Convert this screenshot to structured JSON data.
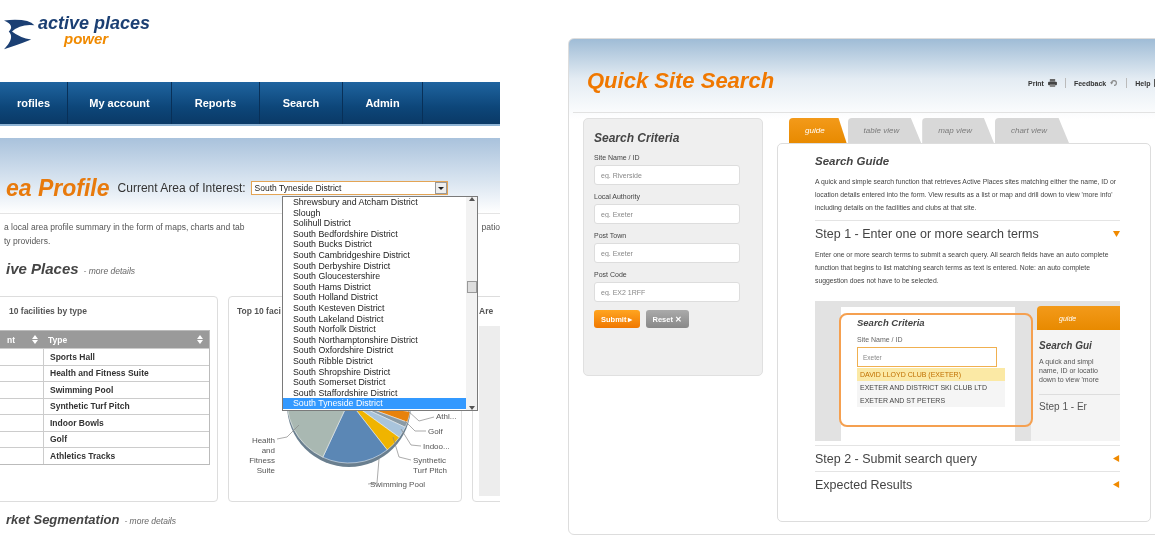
{
  "area_profile": {
    "logo": {
      "title": "active places",
      "subtitle": "power"
    },
    "nav": [
      {
        "label": "rofiles"
      },
      {
        "label": "My account"
      },
      {
        "label": "Reports"
      },
      {
        "label": "Search"
      },
      {
        "label": "Admin"
      }
    ],
    "page_title": "ea Profile",
    "area_label": "Current Area of Interest:",
    "area_select": {
      "value": "South Tyneside District",
      "expanded": true,
      "options": [
        {
          "label": "Shrewsbury and Atcham District",
          "selected": false
        },
        {
          "label": "Slough",
          "selected": false
        },
        {
          "label": "Solihull District",
          "selected": false
        },
        {
          "label": "South Bedfordshire District",
          "selected": false
        },
        {
          "label": "South Bucks District",
          "selected": false
        },
        {
          "label": "South Cambridgeshire District",
          "selected": false
        },
        {
          "label": "South Derbyshire District",
          "selected": false
        },
        {
          "label": "South Gloucestershire",
          "selected": false
        },
        {
          "label": "South Hams District",
          "selected": false
        },
        {
          "label": "South Holland District",
          "selected": false
        },
        {
          "label": "South Kesteven District",
          "selected": false
        },
        {
          "label": "South Lakeland District",
          "selected": false
        },
        {
          "label": "South Norfolk District",
          "selected": false
        },
        {
          "label": "South Northamptonshire District",
          "selected": false
        },
        {
          "label": "South Oxfordshire District",
          "selected": false
        },
        {
          "label": "South Ribble District",
          "selected": false
        },
        {
          "label": "South Shropshire District",
          "selected": false
        },
        {
          "label": "South Somerset District",
          "selected": false
        },
        {
          "label": "South Staffordshire District",
          "selected": false
        },
        {
          "label": "South Tyneside District",
          "selected": true
        }
      ]
    },
    "intro": {
      "line1": "a local area profile summary in the form of maps, charts and tab",
      "line1_right": "patio",
      "line2": "ty providers."
    },
    "section": {
      "heading": "ive Places",
      "more": "- more details"
    },
    "table_card": {
      "title": "10 facilities by type",
      "columns": [
        "nt",
        "Type"
      ],
      "rows": [
        "Sports Hall",
        "Health and Fitness Suite",
        "Swimming Pool",
        "Synthetic Turf Pitch",
        "Indoor Bowls",
        "Golf",
        "Athletics Tracks"
      ]
    },
    "chart_card": {
      "title": "Top 10 faci",
      "pie_labels": [
        {
          "lines": [
            "Athl..."
          ]
        },
        {
          "lines": [
            "Golf"
          ]
        },
        {
          "lines": [
            "Indoo..."
          ]
        },
        {
          "lines": [
            "Synthetic",
            "Turf Pitch"
          ]
        },
        {
          "lines": [
            "Swimming Pool"
          ]
        },
        {
          "lines": [
            "Health",
            "and",
            "Fitness",
            "Suite"
          ]
        }
      ]
    },
    "map_card": {
      "title": "Are"
    },
    "footer_section": {
      "heading": "rket Segmentation",
      "more": "- more details"
    }
  },
  "quick_site_search": {
    "title": "Quick Site Search",
    "links": [
      {
        "label": "Print",
        "kind": "print"
      },
      {
        "label": "Feedback",
        "kind": "feedback"
      },
      {
        "label": "Help",
        "kind": "help"
      }
    ],
    "criteria": {
      "title": "Search Criteria",
      "fields": [
        {
          "label": "Site Name / ID",
          "placeholder": "eg. Riverside"
        },
        {
          "label": "Local Authority",
          "placeholder": "eg. Exeter"
        },
        {
          "label": "Post Town",
          "placeholder": "eg. Exeter"
        },
        {
          "label": "Post Code",
          "placeholder": "eg. EX2 1RFF"
        }
      ],
      "submit": "Submit ▸",
      "reset": "Reset ✕"
    },
    "tabs": [
      {
        "label": "guide",
        "selected": true
      },
      {
        "label": "table view",
        "selected": false
      },
      {
        "label": "map view",
        "selected": false
      },
      {
        "label": "chart view",
        "selected": false
      }
    ],
    "guide": {
      "title": "Search Guide",
      "text": "A quick and simple search function that retrieves Active Places sites matching either the name, ID or location details entered into the form.  View results as a list or map and drill down to view 'more info' including details on the facilities and clubs at that site.",
      "steps": [
        {
          "title": "Step 1 - Enter one or more search terms",
          "expanded": true,
          "text": "Enter one or more search terms to submit a search query.  All search fields have an auto complete function that begins to list matching search terms as text is entered. Note: an auto complete suggestion does not have to be selected."
        },
        {
          "title": "Step 2 - Submit search query",
          "expanded": false
        },
        {
          "title": "Expected Results",
          "expanded": false
        }
      ],
      "screenshot": {
        "criteria_title": "Search Criteria",
        "field_label": "Site Name / ID",
        "field_value": "Exeter",
        "suggestions": [
          {
            "label": "DAVID LLOYD CLUB (EXETER)",
            "selected": true
          },
          {
            "label": "EXETER AND DISTRICT SKI CLUB LTD",
            "selected": false
          },
          {
            "label": "EXETER AND ST PETERS",
            "selected": false
          }
        ],
        "tab_label": "guide",
        "guide_title": "Search Gui",
        "guide_lines": [
          "A quick and simpl",
          "name, ID or locatio",
          "down to view 'more"
        ],
        "step_title": "Step 1 - Er"
      }
    }
  }
}
